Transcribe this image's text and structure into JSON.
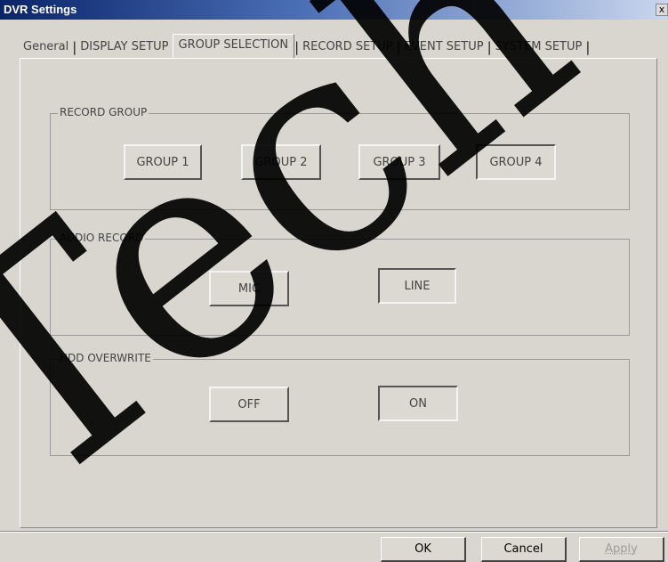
{
  "window": {
    "title": "DVR Settings",
    "close_glyph": "x"
  },
  "tabs": [
    {
      "label": "General",
      "active": false
    },
    {
      "label": "DISPLAY SETUP",
      "active": false
    },
    {
      "label": "GROUP SELECTION",
      "active": true
    },
    {
      "label": "RECORD SETUP",
      "active": false
    },
    {
      "label": "EVENT SETUP",
      "active": false
    },
    {
      "label": "SYSTEM SETUP",
      "active": false
    }
  ],
  "tab_separator": "|",
  "record_group": {
    "legend": "RECORD GROUP",
    "buttons": [
      "GROUP 1",
      "GROUP 2",
      "GROUP 3",
      "GROUP 4"
    ],
    "selected": "GROUP 4"
  },
  "audio_record": {
    "legend": "AUDIO RECORD",
    "buttons": [
      "MIC",
      "LINE"
    ],
    "selected": "LINE"
  },
  "hdd_overwrite": {
    "legend": "HDD OVERWRITE",
    "buttons": [
      "OFF",
      "ON"
    ],
    "selected": "ON"
  },
  "footer": {
    "ok": "OK",
    "cancel": "Cancel",
    "apply": "Apply",
    "apply_enabled": false
  },
  "watermark": "Tech",
  "colors": {
    "title_bar": "#0a246a",
    "dialog_bg": "#d9d5cf",
    "watermark": "#000000"
  }
}
